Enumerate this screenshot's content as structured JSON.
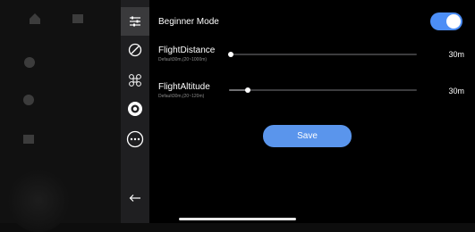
{
  "rail": {
    "items": [
      {
        "icon": "sliders-icon",
        "active": true
      },
      {
        "icon": "no-fly-icon",
        "active": false
      },
      {
        "icon": "drone-icon",
        "active": false
      },
      {
        "icon": "camera-lens-icon",
        "active": false
      },
      {
        "icon": "more-icon",
        "active": false
      },
      {
        "icon": "back-arrow-icon",
        "active": false
      }
    ]
  },
  "settings": {
    "beginner_mode": {
      "label": "Beginner Mode",
      "enabled": true
    },
    "flight_distance": {
      "label": "FlightDistance",
      "hint": "Default30m,(20~1000m)",
      "value": "30m",
      "level": 0.01
    },
    "flight_altitude": {
      "label": "FlightAltitude",
      "hint": "Default30m,(20~120m)",
      "value": "30m",
      "level": 0.1
    },
    "save_label": "Save"
  },
  "colors": {
    "accent": "#4c8ef6",
    "save_button": "#5a95ec",
    "panel_bg": "#000000",
    "rail_bg": "#1f1f21"
  }
}
